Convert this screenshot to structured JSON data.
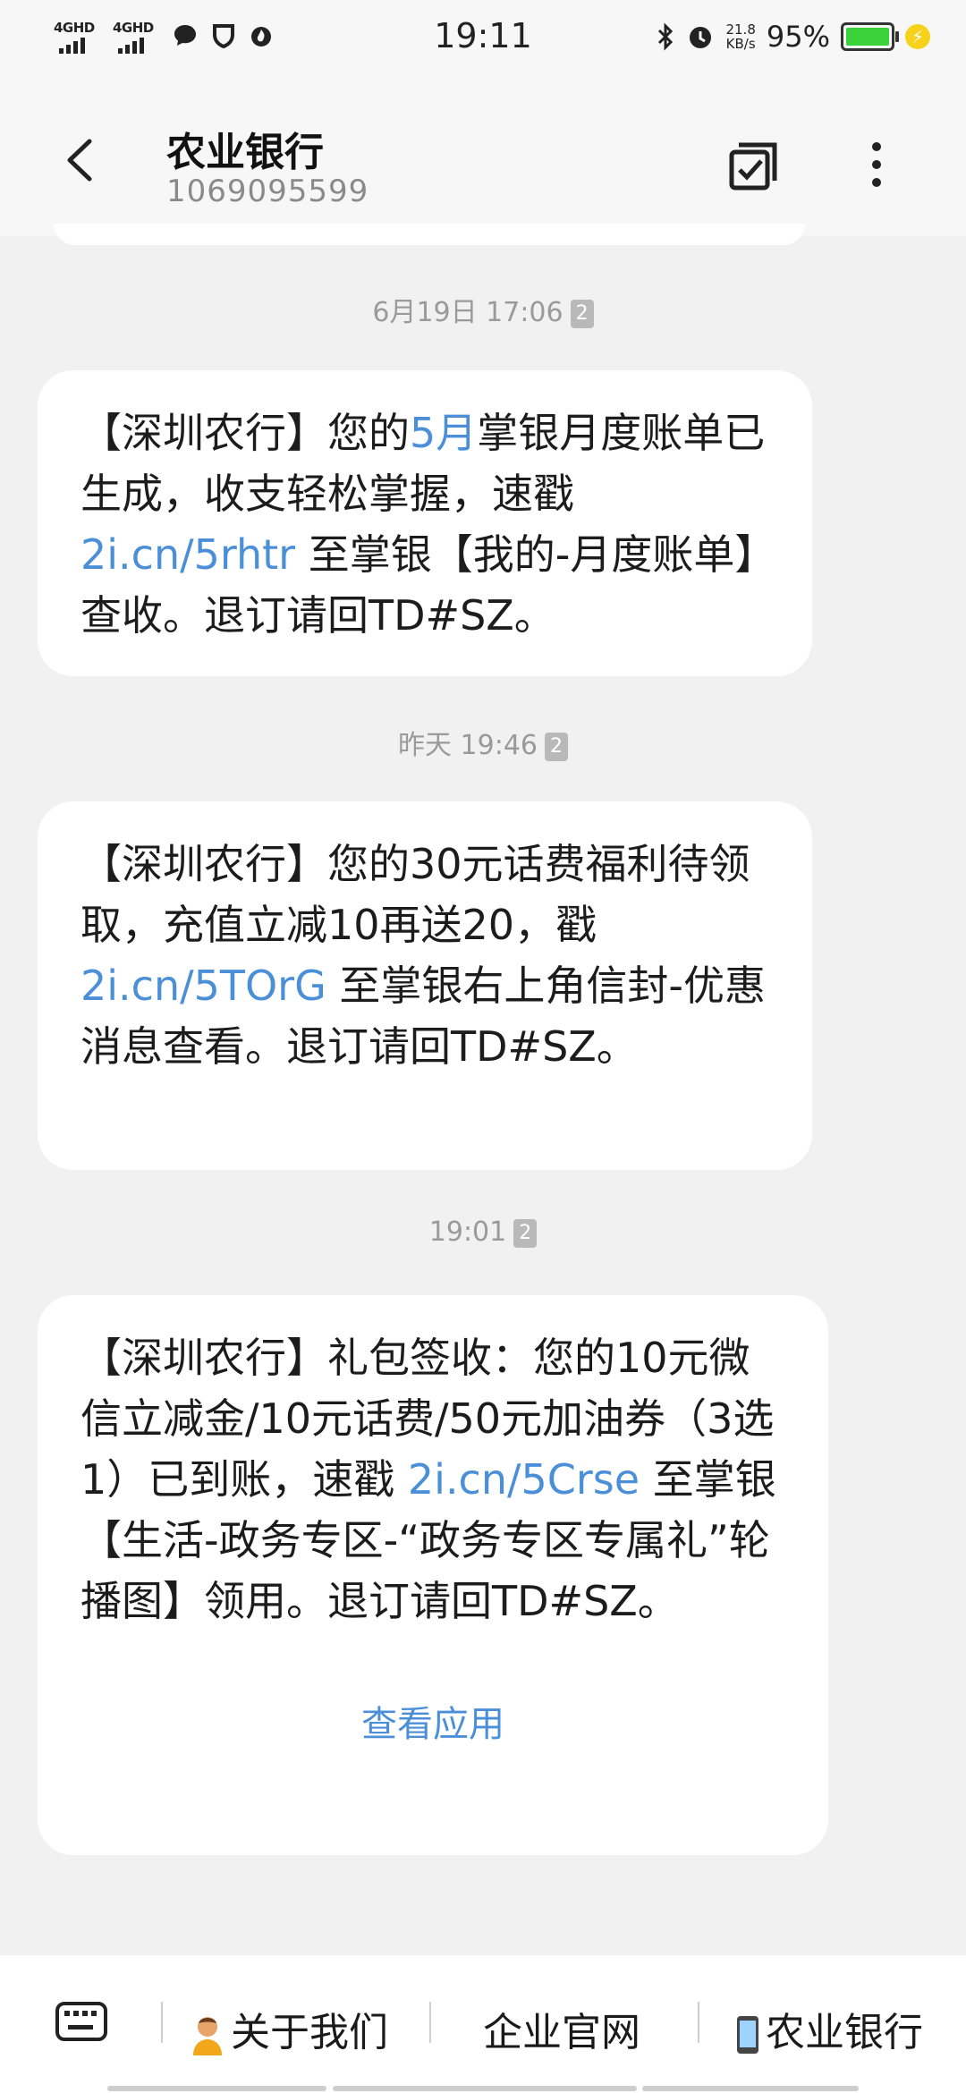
{
  "status": {
    "signal1": "4GHD",
    "signal2": "4GHD",
    "time": "19:11",
    "net_rate": "21.8",
    "net_unit": "KB/s",
    "battery": "95%"
  },
  "header": {
    "title": "农业银行",
    "number": "1069095599"
  },
  "messages": [
    {
      "timestamp": "6月19日 17:06",
      "sim": "2",
      "text_a": "【深圳农行】您的",
      "link_a": "5月",
      "text_b": "掌银月度账单已生成，收支轻松掌握，速戳",
      "link_b": "2i.cn/5rhtr",
      "text_c": " 至掌银【我的-月度账单】查收。退订请回TD#SZ。"
    },
    {
      "timestamp": "昨天 19:46",
      "sim": "2",
      "text_a": "【深圳农行】您的30元话费福利待领取，充值立减10再送20，戳",
      "link_a": "2i.cn/5TOrG",
      "text_b": " 至掌银右上角信封-优惠消息查看。退订请回TD#SZ。"
    },
    {
      "timestamp": "19:01",
      "sim": "2",
      "text_a": "【深圳农行】礼包签收：您的10元微信立减金/10元话费/50元加油券（3选1）已到账，速戳 ",
      "link_a": "2i.cn/5Crse",
      "text_b": " 至掌银【生活-政务专区-“政务专区专属礼”轮播图】领用。退订请回TD#SZ。",
      "action": "查看应用"
    }
  ],
  "bottom_menu": {
    "item1": "关于我们",
    "item2": "企业官网",
    "item3": "农业银行"
  }
}
